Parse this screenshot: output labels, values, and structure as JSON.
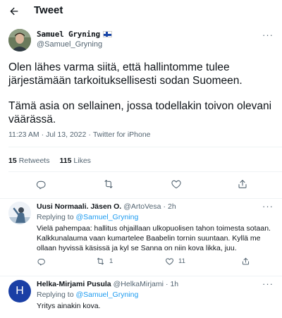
{
  "header": {
    "title": "Tweet"
  },
  "tweet": {
    "author_name": "Samuel Gryning",
    "author_handle": "@Samuel_Gryning",
    "more": "···",
    "paragraphs": [
      "Olen lähes varma siitä, että hallintomme tulee järjestämään tarkoituksellisesti sodan Suomeen.",
      "Tämä asia on sellainen, jossa todellakin toivon olevani väärässä."
    ],
    "time": "11:23 AM",
    "date": "Jul 13, 2022",
    "source": "Twitter for iPhone",
    "separator": "·",
    "retweets_count": "15",
    "retweets_label": "Retweets",
    "likes_count": "115",
    "likes_label": "Likes"
  },
  "replies": [
    {
      "name": "Uusi Normaali. Jäsen O.",
      "handle": "@ArtoVesa",
      "time": "2h",
      "replying_to_label": "Replying to",
      "replying_to": "@Samuel_Gryning",
      "text": "Vielä pahempaa: hallitus ohjaillaan ulkopuolisen tahon toimesta sotaan. Kalkkunalauma vaan kumartelee Baabelin tornin suuntaan. Kyllä me ollaan hyvissä käsissä ja kyl se Sanna on niin kova likka, juu.",
      "retweets": "1",
      "likes": "11"
    },
    {
      "name": "Helka-Mirjami Pusula",
      "handle": "@HelkaMirjami",
      "time": "1h",
      "replying_to_label": "Replying to",
      "replying_to": "@Samuel_Gryning",
      "text": "Yritys ainakin kova.",
      "avatar_letter": "H"
    }
  ],
  "colors": {
    "accent": "#1d9bf0",
    "muted": "#536471",
    "avatar_h": "#1a3fa5"
  }
}
